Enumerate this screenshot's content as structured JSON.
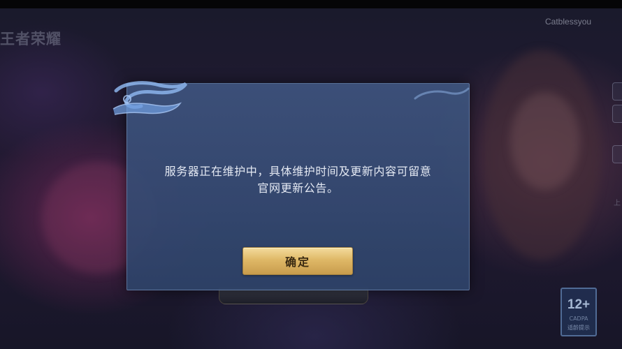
{
  "app": {
    "logo_text": "王者荣耀",
    "player_name": "Catblessyou",
    "side_text": "上"
  },
  "dialog": {
    "message_line1": "服务器正在维护中，具体维护时间及更新内容可留意",
    "message_line2": "官网更新公告。",
    "confirm_label": "确定"
  },
  "age_rating": {
    "number": "12+",
    "subtitle": "CADPA",
    "label": "适龄提示"
  },
  "colors": {
    "dialog_bg": "#3e547e",
    "button_gold": "#dfb867",
    "text": "#e4e9f3"
  }
}
